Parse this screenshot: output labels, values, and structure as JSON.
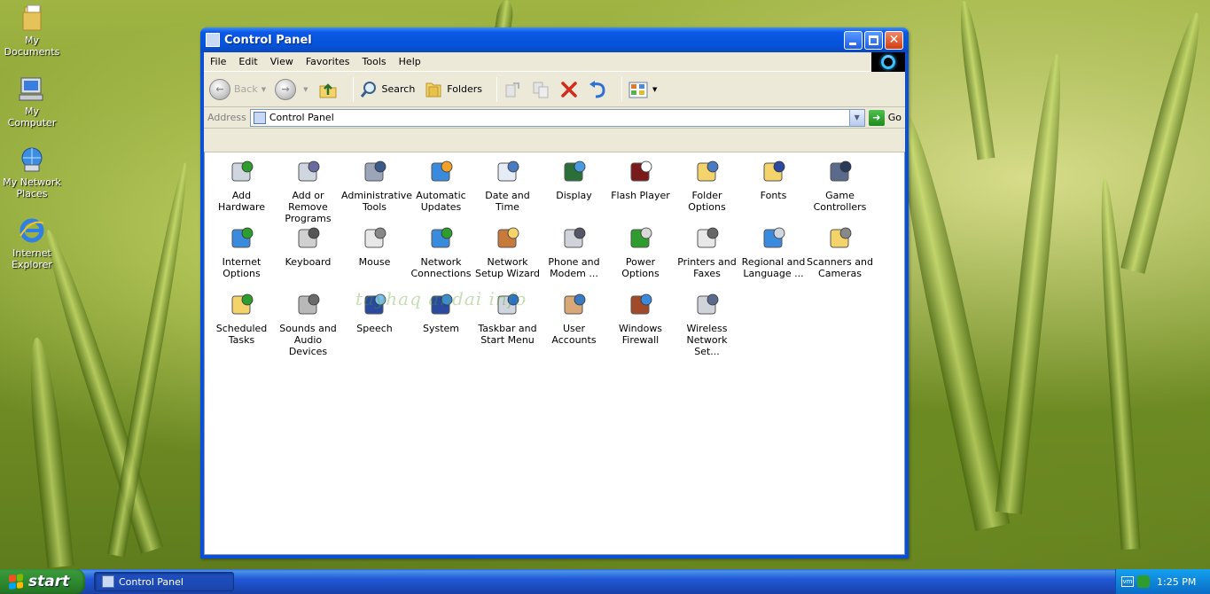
{
  "desktop": {
    "icons": [
      {
        "label": "My Documents"
      },
      {
        "label": "My Computer"
      },
      {
        "label": "My Network Places"
      },
      {
        "label": "Internet Explorer"
      }
    ]
  },
  "window": {
    "title": "Control Panel",
    "menu": [
      "File",
      "Edit",
      "View",
      "Favorites",
      "Tools",
      "Help"
    ],
    "toolbar": {
      "back": "Back",
      "search": "Search",
      "folders": "Folders"
    },
    "address": {
      "label": "Address",
      "value": "Control Panel",
      "go": "Go"
    },
    "items": [
      {
        "label": "Add Hardware",
        "icon": "add-hardware-icon"
      },
      {
        "label": "Add or Remove Programs",
        "icon": "add-remove-programs-icon"
      },
      {
        "label": "Administrative Tools",
        "icon": "administrative-tools-icon"
      },
      {
        "label": "Automatic Updates",
        "icon": "automatic-updates-icon"
      },
      {
        "label": "Date and Time",
        "icon": "date-time-icon"
      },
      {
        "label": "Display",
        "icon": "display-icon"
      },
      {
        "label": "Flash Player",
        "icon": "flash-player-icon"
      },
      {
        "label": "Folder Options",
        "icon": "folder-options-icon"
      },
      {
        "label": "Fonts",
        "icon": "fonts-icon"
      },
      {
        "label": "Game Controllers",
        "icon": "game-controllers-icon"
      },
      {
        "label": "Internet Options",
        "icon": "internet-options-icon"
      },
      {
        "label": "Keyboard",
        "icon": "keyboard-icon"
      },
      {
        "label": "Mouse",
        "icon": "mouse-icon"
      },
      {
        "label": "Network Connections",
        "icon": "network-connections-icon"
      },
      {
        "label": "Network Setup Wizard",
        "icon": "network-setup-wizard-icon"
      },
      {
        "label": "Phone and Modem ...",
        "icon": "phone-modem-icon"
      },
      {
        "label": "Power Options",
        "icon": "power-options-icon"
      },
      {
        "label": "Printers and Faxes",
        "icon": "printers-faxes-icon"
      },
      {
        "label": "Regional and Language ...",
        "icon": "regional-language-icon"
      },
      {
        "label": "Scanners and Cameras",
        "icon": "scanners-cameras-icon"
      },
      {
        "label": "Scheduled Tasks",
        "icon": "scheduled-tasks-icon"
      },
      {
        "label": "Sounds and Audio Devices",
        "icon": "sounds-audio-icon"
      },
      {
        "label": "Speech",
        "icon": "speech-icon"
      },
      {
        "label": "System",
        "icon": "system-icon"
      },
      {
        "label": "Taskbar and Start Menu",
        "icon": "taskbar-start-menu-icon"
      },
      {
        "label": "User Accounts",
        "icon": "user-accounts-icon"
      },
      {
        "label": "Windows Firewall",
        "icon": "windows-firewall-icon"
      },
      {
        "label": "Wireless Network Set...",
        "icon": "wireless-network-icon"
      }
    ],
    "watermark": "tayhaq andai info"
  },
  "taskbar": {
    "start": "start",
    "task": "Control Panel",
    "clock": "1:25 PM"
  }
}
